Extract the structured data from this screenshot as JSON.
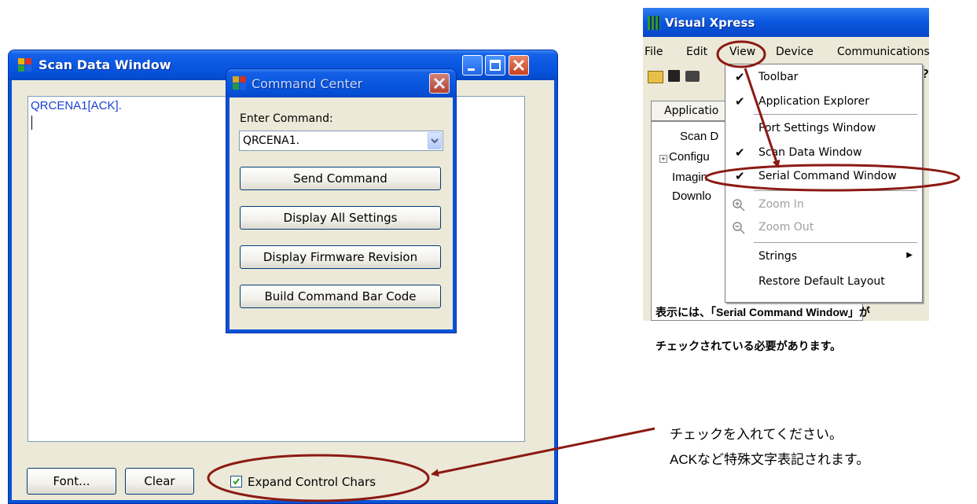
{
  "scan_window": {
    "title": "Scan Data Window",
    "text_line": "QRCENA1[ACK].",
    "font_button": "Font...",
    "clear_button": "Clear",
    "expand_label": "Expand Control Chars",
    "expand_checked": true
  },
  "command_center": {
    "title": "Command Center",
    "enter_label": "Enter Command:",
    "command_value": "QRCENA1.",
    "buttons": [
      "Send  Command",
      "Display All Settings",
      "Display Firmware Revision",
      "Build Command Bar Code"
    ]
  },
  "visual_xpress": {
    "title": "Visual Xpress",
    "menubar": [
      "File",
      "Edit",
      "View",
      "Device",
      "Communications"
    ],
    "tab_label": "Applicatio",
    "tree": [
      "Scan D",
      "Configu",
      "Imagin",
      "Downlo"
    ],
    "view_menu": [
      {
        "label": "Toolbar",
        "checked": true,
        "enabled": true
      },
      {
        "label": "Application Explorer",
        "checked": true,
        "enabled": true
      },
      {
        "label": "Port Settings Window",
        "checked": false,
        "enabled": true
      },
      {
        "label": "Scan Data Window",
        "checked": true,
        "enabled": true
      },
      {
        "label": "Serial Command Window",
        "checked": true,
        "enabled": true
      },
      {
        "label": "Zoom In",
        "checked": false,
        "enabled": false,
        "icon": "zoom-in-icon"
      },
      {
        "label": "Zoom Out",
        "checked": false,
        "enabled": false,
        "icon": "zoom-out-icon"
      },
      {
        "label": "Strings",
        "checked": false,
        "enabled": true,
        "submenu": true
      },
      {
        "label": "Restore Default Layout",
        "checked": false,
        "enabled": true
      }
    ]
  },
  "notes": {
    "caption_line1": "表示には、「Serial Command Window」が",
    "caption_line2": "チェックされている必要があります。",
    "note_line1": "チェックを入れてください。",
    "note_line2": "ACKなど特殊文字表記されます。"
  },
  "colors": {
    "highlight_outline": "#8b1a12",
    "xp_blue": "#0a52d6",
    "xp_face": "#ece9d8",
    "scan_text": "#1a3fd0"
  }
}
